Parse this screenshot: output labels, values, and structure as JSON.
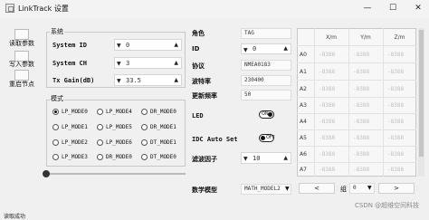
{
  "window": {
    "title": "LinkTrack 设置",
    "minimize": "—",
    "maximize": "☐",
    "close": "✕"
  },
  "toolbar": {
    "read_label": "读取参数",
    "write_label": "写入参数",
    "restart_label": "重启节点"
  },
  "system": {
    "group_label": "系统",
    "fields": [
      {
        "label": "System ID",
        "value": "0"
      },
      {
        "label": "System CH",
        "value": "3"
      },
      {
        "label": "Tx Gain(dB)",
        "value": "33.5"
      }
    ]
  },
  "mode": {
    "group_label": "模式",
    "options": [
      [
        "LP_MODE0",
        "LP_MODE4",
        "DR_MODE0"
      ],
      [
        "LP_MODE1",
        "LP_MODE5",
        "DR_MODE1"
      ],
      [
        "LP_MODE2",
        "LP_MODE6",
        "DT_MODE1"
      ],
      [
        "LP_MODE3",
        "DR_MODE0",
        "DT_MODE0"
      ]
    ],
    "selected": "LP_MODE0"
  },
  "settings": {
    "role_label": "角色",
    "role_value": "TAG",
    "id_label": "ID",
    "id_value": "0",
    "protocol_label": "协议",
    "protocol_value": "NMEA0183",
    "baud_label": "波特率",
    "baud_value": "230400",
    "rate_label": "更新频率",
    "rate_value": "50",
    "led_label": "LED",
    "led_state": "ON",
    "idc_label": "IDC Auto Set",
    "idc_state": "OFF",
    "filter_label": "滤波因子",
    "filter_value": "10",
    "math_label": "数学模型",
    "math_value": "MATH_MODEL2"
  },
  "table": {
    "headers": [
      "X/m",
      "Y/m",
      "Z/m"
    ],
    "rows": [
      {
        "label": "A0",
        "x": "-8388",
        "y": "-8388",
        "z": "-8388"
      },
      {
        "label": "A1",
        "x": "-8388",
        "y": "-8388",
        "z": "-8388"
      },
      {
        "label": "A2",
        "x": "-8388",
        "y": "-8388",
        "z": "-8388"
      },
      {
        "label": "A3",
        "x": "-8388",
        "y": "-8388",
        "z": "-8388"
      },
      {
        "label": "A4",
        "x": "-8388",
        "y": "-8388",
        "z": "-8388"
      },
      {
        "label": "A5",
        "x": "-8388",
        "y": "-8388",
        "z": "-8388"
      },
      {
        "label": "A6",
        "x": "-8388",
        "y": "-8388",
        "z": "-8388"
      },
      {
        "label": "A7",
        "x": "-8388",
        "y": "-8388",
        "z": "-8388"
      }
    ],
    "prev": "<",
    "next": ">",
    "group_label": "组",
    "group_value": "0"
  },
  "watermark": "CSDN @超维空间科技",
  "bottom_partial": "读取成功"
}
